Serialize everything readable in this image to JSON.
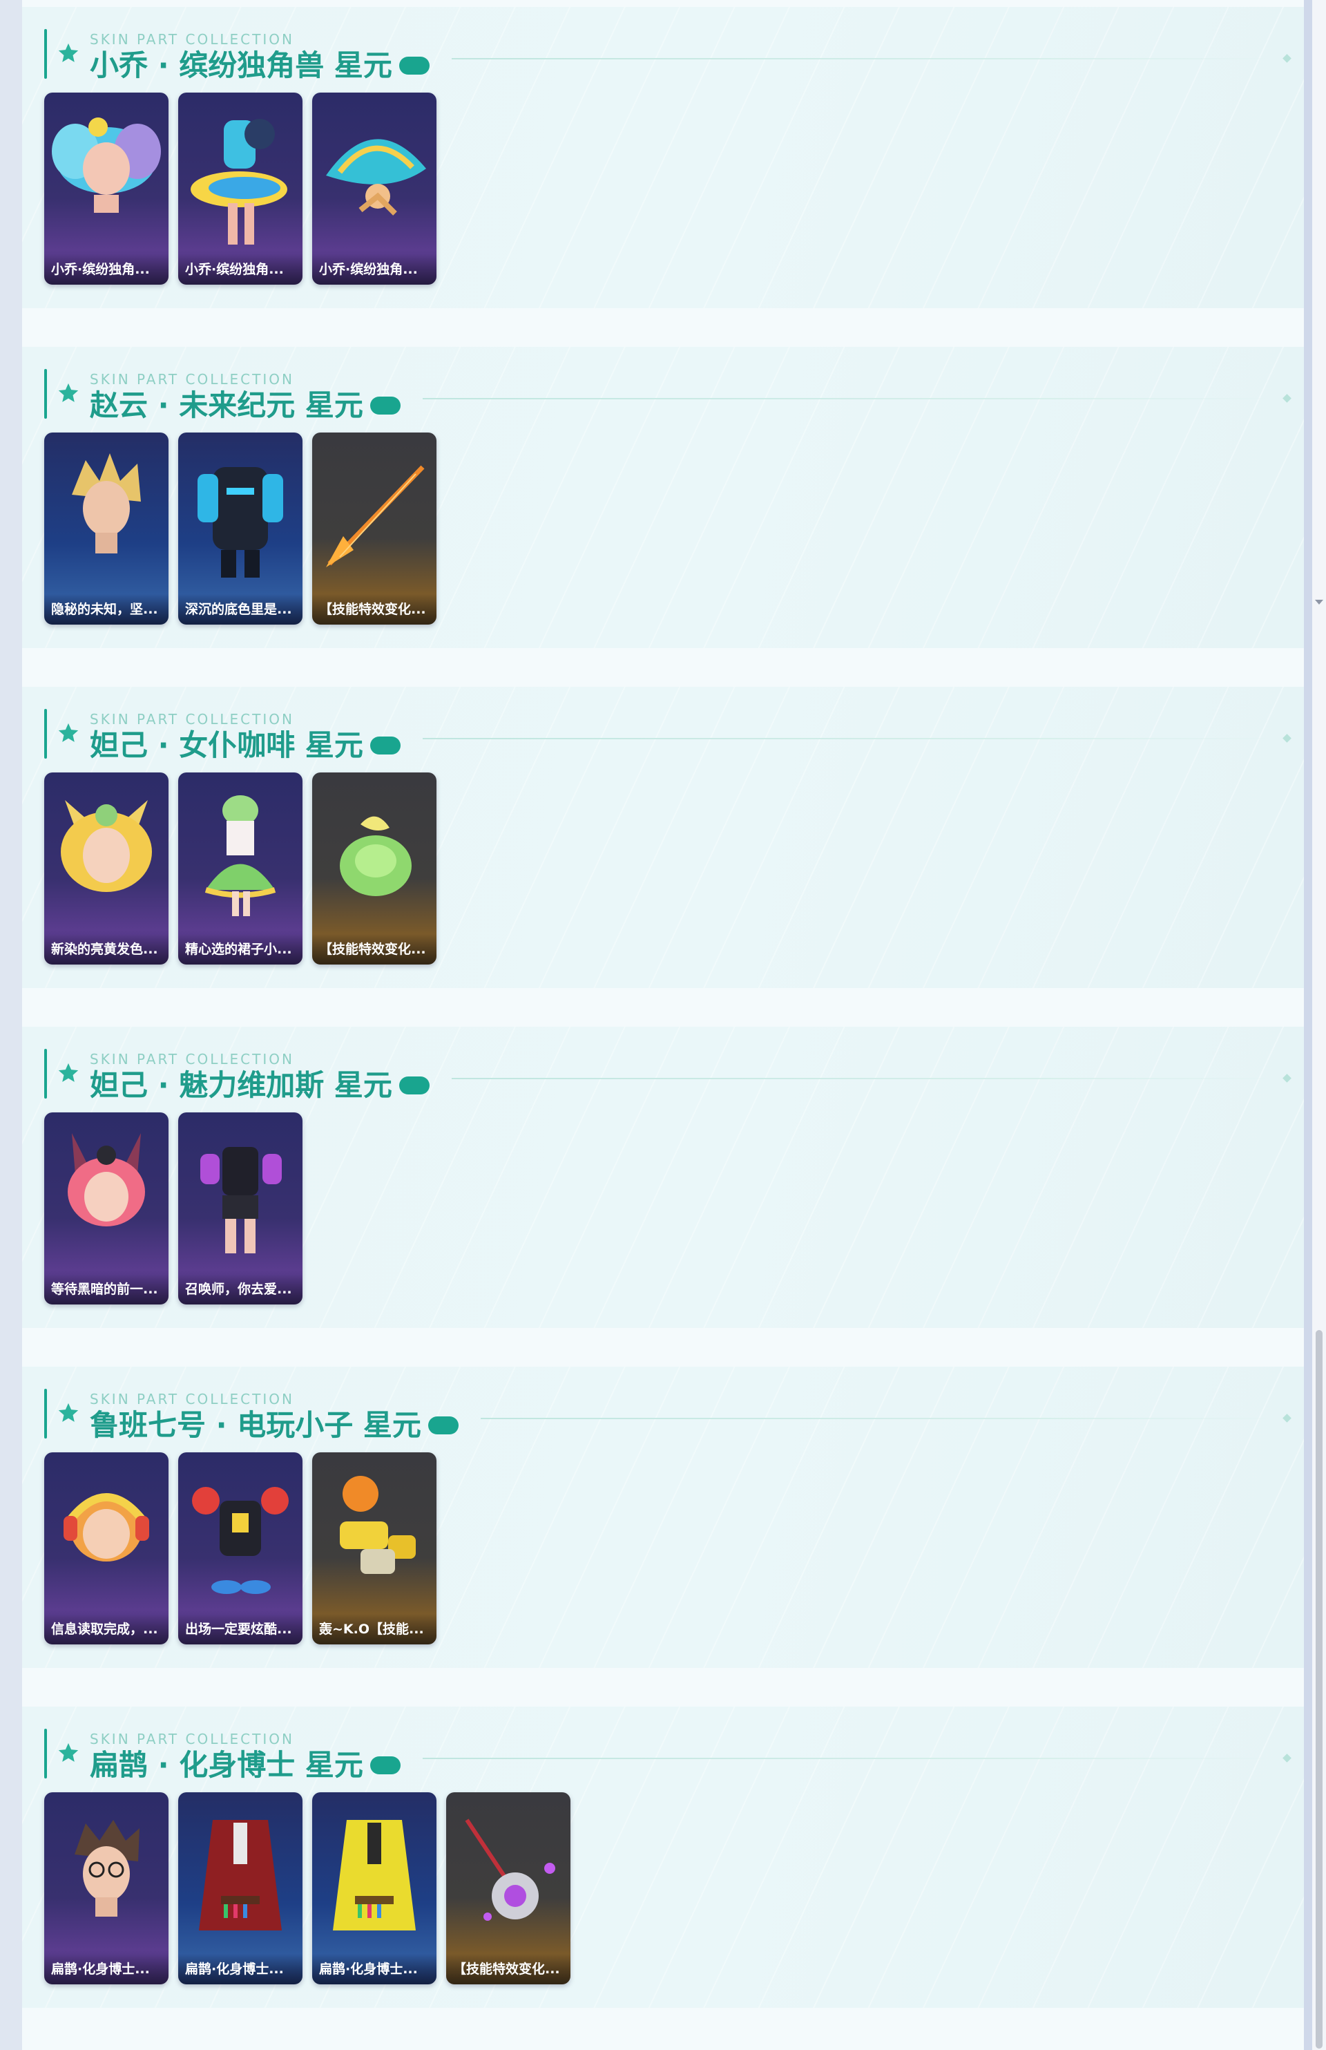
{
  "colors": {
    "accent": "#19a58f",
    "title": "#1f9c8b",
    "section_bg": "#e9f6f8",
    "page_bg": "#f4fafc",
    "card_purple": "#38306f",
    "card_blue": "#1e3f86",
    "card_dark": "#3f3e3d"
  },
  "sections": [
    {
      "eyebrow": "SKIN PART COLLECTION",
      "title": "小乔 · 缤纷独角兽 星元",
      "cards": [
        {
          "label": "小乔·缤纷独角...",
          "icon": "hair-part-icon",
          "theme": "purple"
        },
        {
          "label": "小乔·缤纷独角...",
          "icon": "outfit-part-icon",
          "theme": "purple"
        },
        {
          "label": "小乔·缤纷独角...",
          "icon": "fan-weapon-icon",
          "theme": "purple"
        }
      ]
    },
    {
      "eyebrow": "SKIN PART COLLECTION",
      "title": "赵云 · 未来纪元 星元",
      "cards": [
        {
          "label": "隐秘的未知，坚...",
          "icon": "head-part-icon",
          "theme": "blue"
        },
        {
          "label": "深沉的底色里是...",
          "icon": "armor-part-icon",
          "theme": "blue"
        },
        {
          "label": "【技能特效变化...",
          "icon": "spear-effect-icon",
          "theme": "dark"
        }
      ]
    },
    {
      "eyebrow": "SKIN PART COLLECTION",
      "title": "妲己 · 女仆咖啡 星元",
      "cards": [
        {
          "label": "新染的亮黄发色...",
          "icon": "head-part-icon",
          "theme": "purple"
        },
        {
          "label": "精心选的裙子小...",
          "icon": "dress-part-icon",
          "theme": "purple"
        },
        {
          "label": "【技能特效变化...",
          "icon": "skill-effect-icon",
          "theme": "dark"
        }
      ]
    },
    {
      "eyebrow": "SKIN PART COLLECTION",
      "title": "妲己 · 魅力维加斯 星元",
      "cards": [
        {
          "label": "等待黑暗的前一...",
          "icon": "head-part-icon",
          "theme": "purple"
        },
        {
          "label": "召唤师，你去爱...",
          "icon": "outfit-part-icon",
          "theme": "purple"
        }
      ]
    },
    {
      "eyebrow": "SKIN PART COLLECTION",
      "title": "鲁班七号 · 电玩小子 星元",
      "cards": [
        {
          "label": "信息读取完成，...",
          "icon": "head-part-icon",
          "theme": "purple"
        },
        {
          "label": "出场一定要炫酷...",
          "icon": "outfit-part-icon",
          "theme": "purple"
        },
        {
          "label": "轰~K.O【技能...",
          "icon": "blaster-weapon-icon",
          "theme": "dark"
        }
      ]
    },
    {
      "eyebrow": "SKIN PART COLLECTION",
      "title": "扁鹊 · 化身博士 星元",
      "cards": [
        {
          "label": "扁鹊·化身博士...",
          "icon": "head-part-icon",
          "theme": "purple"
        },
        {
          "label": "扁鹊·化身博士...",
          "icon": "coat-part-icon",
          "theme": "blue"
        },
        {
          "label": "扁鹊·化身博士...",
          "icon": "coat-part-icon",
          "theme": "blue"
        },
        {
          "label": "【技能特效变化...",
          "icon": "skill-effect-icon",
          "theme": "dark"
        }
      ]
    }
  ]
}
